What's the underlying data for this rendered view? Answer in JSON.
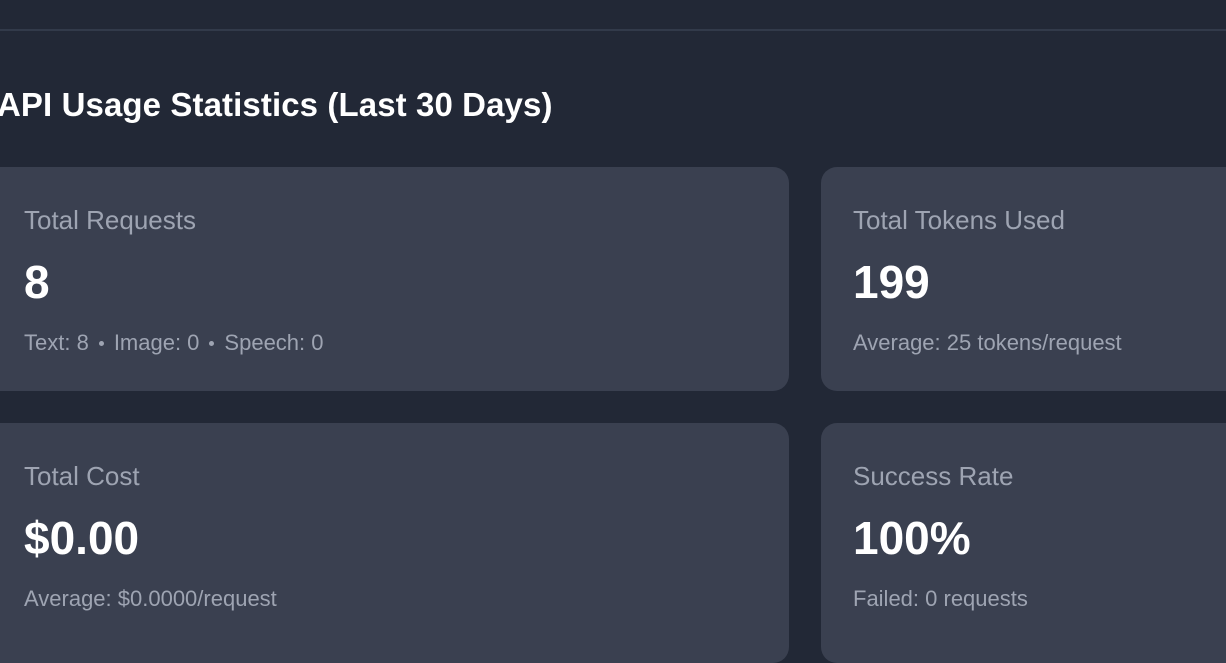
{
  "section": {
    "title": "API Usage Statistics (Last 30 Days)"
  },
  "cards": {
    "total_requests": {
      "label": "Total Requests",
      "value": "8",
      "breakdown": {
        "text": "Text: 8",
        "image": "Image: 0",
        "speech": "Speech: 0"
      }
    },
    "total_tokens": {
      "label": "Total Tokens Used",
      "value": "199",
      "sub": "Average: 25 tokens/request"
    },
    "total_cost": {
      "label": "Total Cost",
      "value": "$0.00",
      "sub": "Average: $0.0000/request"
    },
    "success_rate": {
      "label": "Success Rate",
      "value": "100%",
      "sub": "Failed: 0 requests"
    }
  },
  "colors": {
    "background": "#222836",
    "card": "#3a4050",
    "muted_text": "#9ea4b2",
    "primary_text": "#ffffff"
  }
}
